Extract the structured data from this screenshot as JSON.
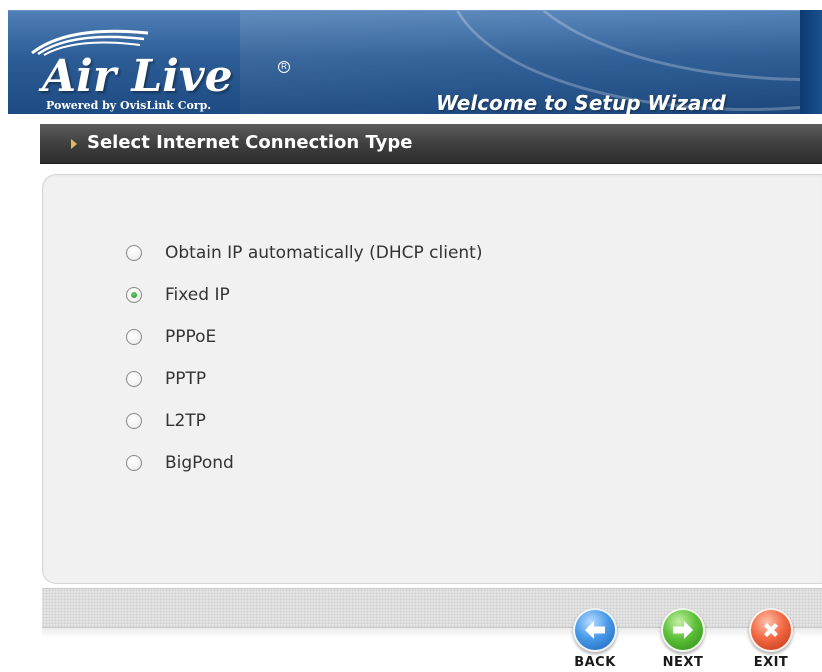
{
  "header": {
    "logo_text": "Air Live",
    "logo_tagline": "Powered by OvisLink Corp.",
    "wizard_title": "Welcome to Setup Wizard"
  },
  "section": {
    "title": "Select Internet Connection Type"
  },
  "connection_types": {
    "selected": "Fixed IP",
    "options": [
      {
        "label": "Obtain IP automatically (DHCP client)",
        "checked": false
      },
      {
        "label": "Fixed IP",
        "checked": true
      },
      {
        "label": "PPPoE",
        "checked": false
      },
      {
        "label": "PPTP",
        "checked": false
      },
      {
        "label": "L2TP",
        "checked": false
      },
      {
        "label": "BigPond",
        "checked": false
      }
    ]
  },
  "footer": {
    "back_label": "BACK",
    "next_label": "NEXT",
    "exit_label": "EXIT"
  },
  "colors": {
    "banner_blue": "#2d5d96",
    "section_bar": "#3d3d3d",
    "panel_bg": "#f1f1f1",
    "back_button": "#4a9bea",
    "next_button": "#5ec13a",
    "exit_button": "#f26a45"
  },
  "icons": {
    "back": "arrow-left-icon",
    "next": "arrow-right-icon",
    "exit": "close-icon"
  }
}
